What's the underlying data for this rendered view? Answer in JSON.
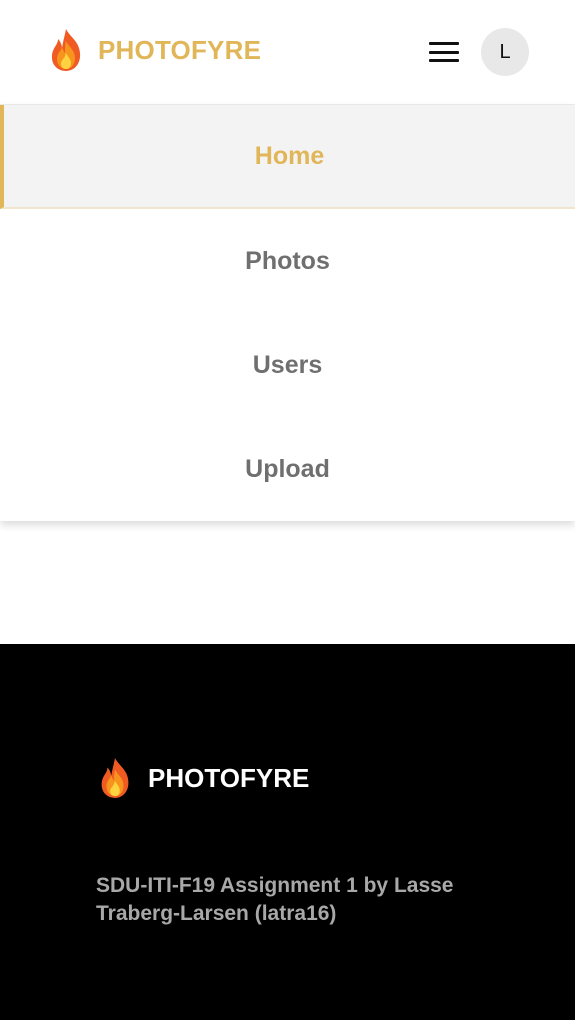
{
  "header": {
    "brand_name": "PHOTOFYRE",
    "logo_icon": "fire-icon",
    "menu_icon": "hamburger-menu-icon",
    "avatar_initial": "L"
  },
  "nav": {
    "items": [
      {
        "label": "Home",
        "active": true
      },
      {
        "label": "Photos",
        "active": false
      },
      {
        "label": "Users",
        "active": false
      },
      {
        "label": "Upload",
        "active": false
      }
    ]
  },
  "footer": {
    "brand_name": "PHOTOFYRE",
    "logo_icon": "fire-icon",
    "credit_text": "SDU-ITI-F19 Assignment 1 by Lasse Traberg-Larsen (latra16)"
  },
  "colors": {
    "accent": "#e0b658",
    "nav_text": "#6f6f6f",
    "active_bg": "#f3f3f3",
    "footer_bg": "#000000",
    "footer_text": "#a8a8a8"
  }
}
